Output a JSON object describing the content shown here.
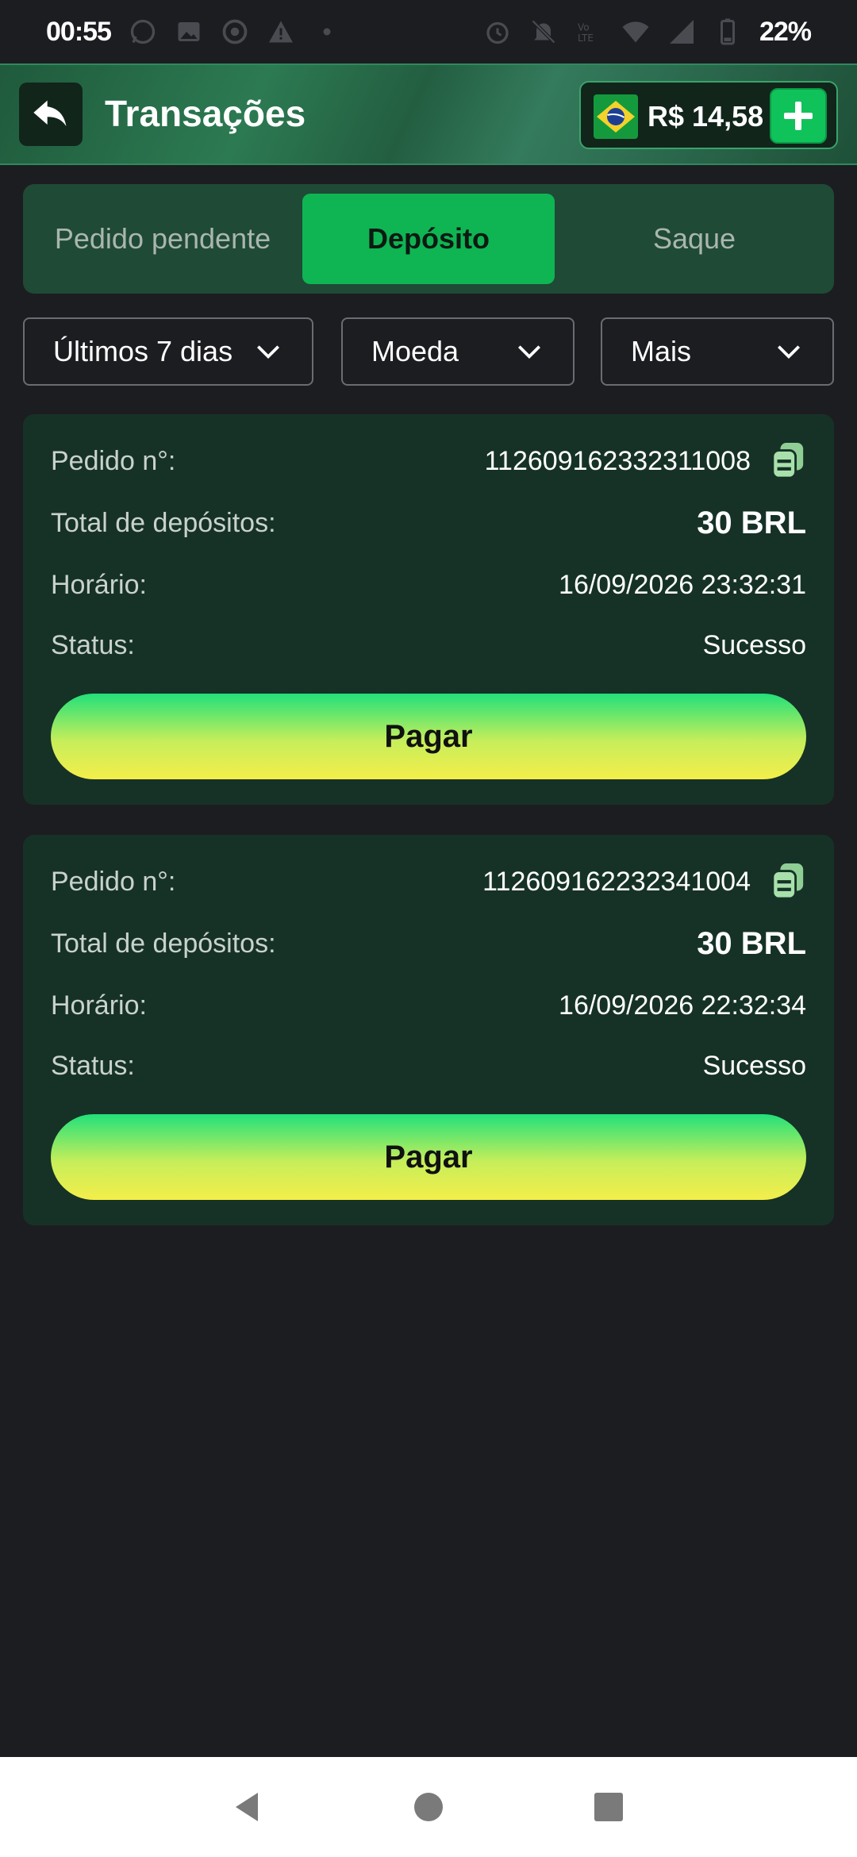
{
  "status_bar": {
    "time": "00:55",
    "battery": "22%",
    "icons": [
      "whatsapp-icon",
      "image-icon",
      "chrome-icon",
      "warning-icon",
      "dot-icon",
      "alarm-icon",
      "mute-icon",
      "volte-icon",
      "wifi-icon",
      "signal-icon",
      "battery-icon"
    ]
  },
  "header": {
    "title": "Transações",
    "balance": "R$ 14,58",
    "flag": "brazil-flag-icon"
  },
  "tabs": [
    {
      "label": "Pedido pendente",
      "active": false
    },
    {
      "label": "Depósito",
      "active": true
    },
    {
      "label": "Saque",
      "active": false
    }
  ],
  "filters": {
    "days": "Últimos 7 dias",
    "currency": "Moeda",
    "more": "Mais"
  },
  "labels": {
    "order": "Pedido n°:",
    "total": "Total de depósitos:",
    "time": "Horário:",
    "status": "Status:",
    "pay": "Pagar"
  },
  "transactions": [
    {
      "order_no": "112609162332311008",
      "total": "30 BRL",
      "time": "16/09/2026 23:32:31",
      "status": "Sucesso"
    },
    {
      "order_no": "112609162232341004",
      "total": "30 BRL",
      "time": "16/09/2026 22:32:34",
      "status": "Sucesso"
    }
  ],
  "colors": {
    "accent": "#0fb553",
    "background": "#1c1d21",
    "card": "#163226"
  }
}
